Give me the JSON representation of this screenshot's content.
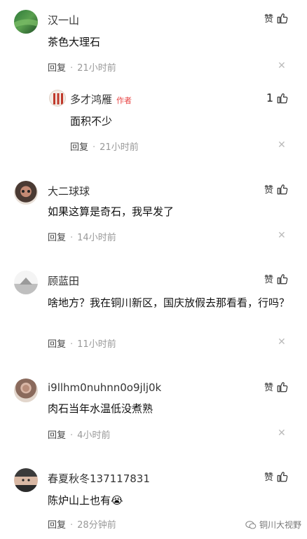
{
  "like_label": "赞",
  "reply_label": "回复",
  "author_badge": "作者",
  "comments": [
    {
      "user": "汉一山",
      "text": "茶色大理石",
      "time": "21小时前"
    },
    {
      "user": "多才鸿雁",
      "text": "面积不少",
      "time": "21小时前",
      "likes": "1"
    },
    {
      "user": "大二球球",
      "text": "如果这算是奇石，我早发了",
      "time": "14小时前"
    },
    {
      "user": "顾蓝田",
      "text": "啥地方？我在铜川新区，国庆放假去那看看，行吗？",
      "time": "11小时前"
    },
    {
      "user": "i9llhm0nuhnn0o9jlj0k",
      "text": "肉石当年水温低没煮熟",
      "time": "4小时前"
    },
    {
      "user": "春夏秋冬137117831",
      "text": "陈炉山上也有😭",
      "time": "28分钟前"
    }
  ],
  "watermark": "铜川大视野",
  "colors": {
    "author_badge": "#e84545",
    "meta_time": "#999999",
    "background": "#ffffff"
  }
}
